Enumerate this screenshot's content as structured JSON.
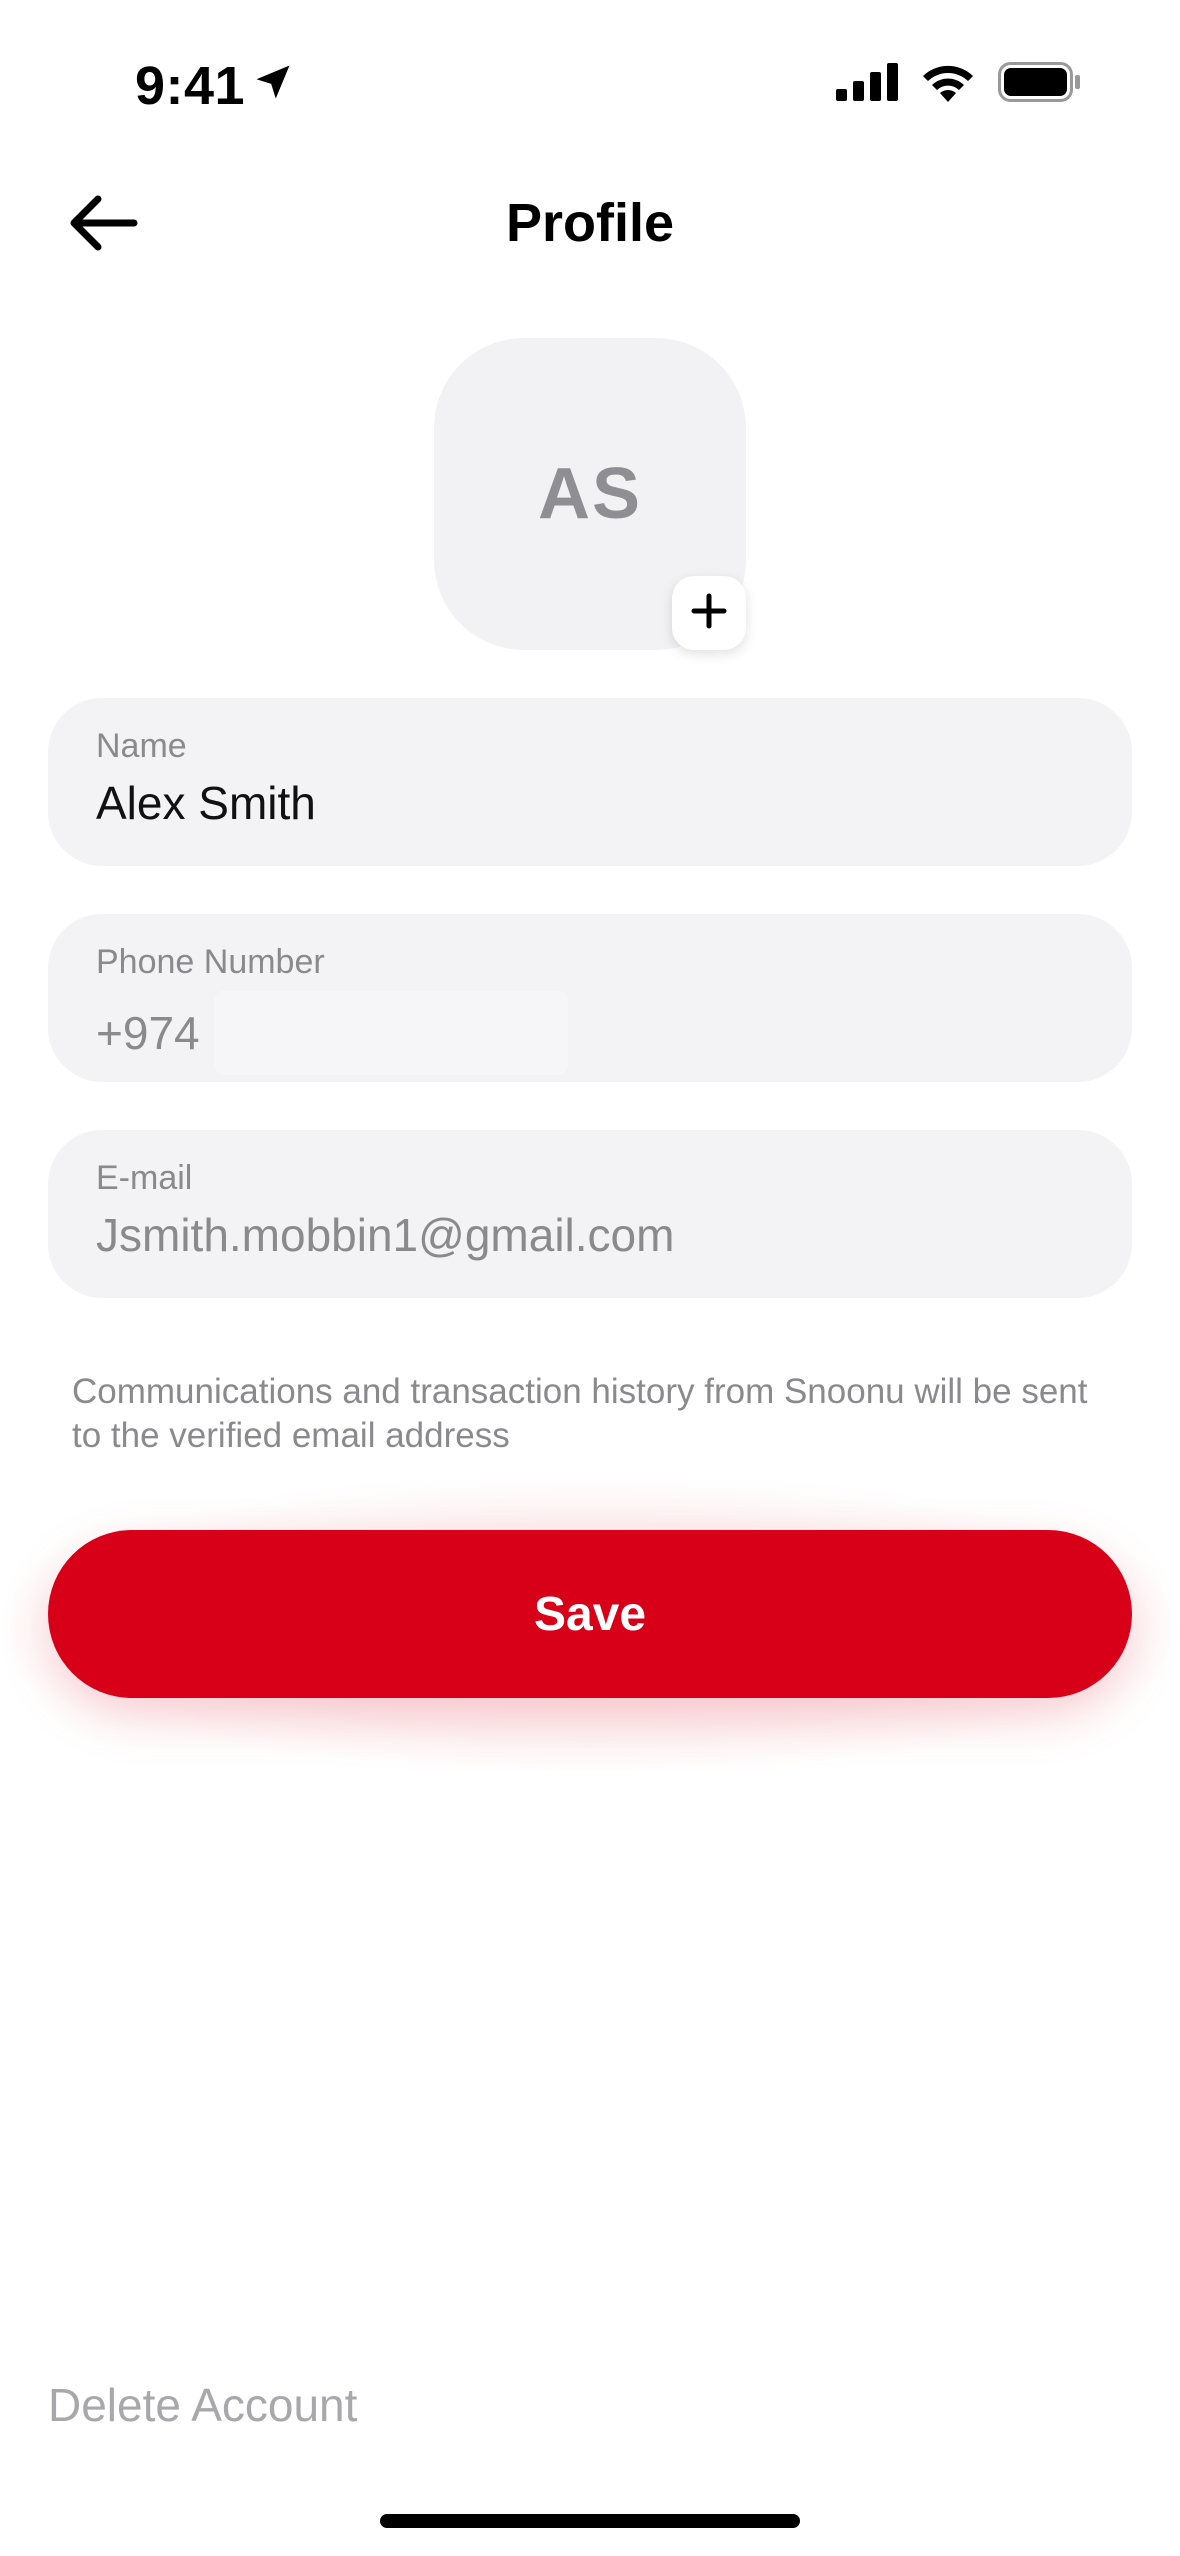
{
  "status_bar": {
    "time": "9:41",
    "icons": [
      "location-arrow-icon",
      "cellular-signal-icon",
      "wifi-icon",
      "battery-icon"
    ]
  },
  "header": {
    "title": "Profile",
    "back_icon": "arrow-left-icon"
  },
  "avatar": {
    "initials": "AS",
    "add_icon": "plus-icon"
  },
  "form": {
    "name": {
      "label": "Name",
      "value": "Alex Smith"
    },
    "phone": {
      "label": "Phone Number",
      "prefix": "+974",
      "value": ""
    },
    "email": {
      "label": "E-mail",
      "value": "Jsmith.mobbin1@gmail.com"
    }
  },
  "hint_text": "Communications and transaction history from Snoonu will be sent to the verified email address",
  "save_label": "Save",
  "delete_label": "Delete Account",
  "colors": {
    "accent": "#D80019",
    "field_bg": "#F3F3F5",
    "muted_text": "#8A8A8E"
  }
}
